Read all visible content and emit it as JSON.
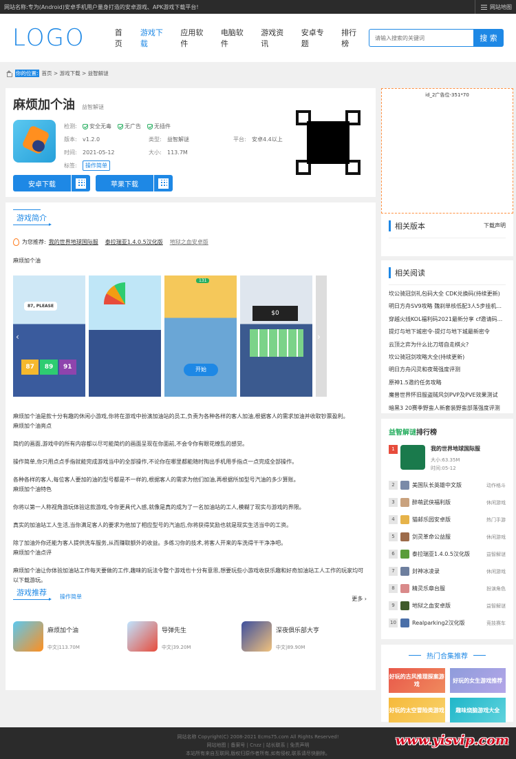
{
  "topbar": {
    "text": "网站名称:专为(Android)安卓手机用户量身打造的安卓游戏、APK游戏下载平台!",
    "sitemap": "网站地图"
  },
  "header": {
    "logo": "LOGO",
    "nav": [
      "首页",
      "游戏下载",
      "应用软件",
      "电脑软件",
      "游戏资讯",
      "安卓专题",
      "排行榜"
    ],
    "active_nav": "游戏下载",
    "search_placeholder": "请输入搜索的关键词",
    "search_button": "搜 索"
  },
  "breadcrumb": {
    "here": "你的位置:",
    "path": "首页 > 游戏下载 > 益智解谜"
  },
  "game": {
    "title": "麻烦加个油",
    "category": "益智解谜",
    "check_label": "检测:",
    "checks": [
      "安全无毒",
      "无广告",
      "无插件"
    ],
    "version_label": "版本:",
    "version": "v1.2.0",
    "type_label": "类型:",
    "type": "益智解谜",
    "platform_label": "平台:",
    "platform": "安卓4.4以上",
    "time_label": "时间:",
    "time": "2021-05-12",
    "size_label": "大小:",
    "size": "113.7M",
    "tag_label": "标签:",
    "tag": "操作简单",
    "android_btn": "安卓下载",
    "ios_btn": "苹果下载"
  },
  "ad": {
    "text": "id_2广告位-351*70"
  },
  "intro": {
    "section_title": "游戏简介",
    "rec_label": "为您推荐:",
    "rec_links": [
      "我的世界地球国际服",
      "泰拉瑞亚1.4.0.5汉化版",
      "地狱之血安卓版"
    ],
    "name_line": "麻烦加个油",
    "shots": {
      "bubble": "87, PLEASE",
      "blocks": [
        "87",
        "89",
        "91"
      ],
      "badge": "131",
      "start": "开始",
      "money": "$0"
    },
    "paragraphs": [
      {
        "text": "麻烦加个油是款十分有趣的休闲小游戏,你将在游戏中扮演加油站的员工,负责为各种各样的客人加油,根据客人的需求加油并收取钞票盈利。",
        "sub": "麻烦加个油亮点"
      },
      {
        "text": "简约的画面,游戏中的所有内容都以尽可能简约的画面呈现在你面前,不会令你有眼花缭乱的感觉。",
        "sub": ""
      },
      {
        "text": "操作简单,你只用点点手指就能完成游戏当中的全部操作,不论你在哪里都能随时掏出手机用手指点一点完成全部操作。",
        "sub": ""
      },
      {
        "text": "各种各样的客人,每位客人要加的油的型号都是不一样的,根据客人的需求为他们加油,再根据所加型号汽油的多少算账。",
        "sub": "麻烦加个油特色"
      },
      {
        "text": "你将以第一人称视角游玩体验这款游戏,令你更具代入感,就像是真的成为了一名加油站的工人,模糊了现实与游戏的界限。",
        "sub": ""
      },
      {
        "text": "真实的加油站工人生活,当你满足客人的要求为他加了相应型号的汽油后,你将获得奖励也就是现实生活当中的工资。",
        "sub": ""
      },
      {
        "text": "除了加油外你还能为客人提供洗车服务,从而赚取额外的收益。多练习你的技术,将客人开来的车洗得干干净净吧。",
        "sub": "麻烦加个油点评"
      },
      {
        "text": "麻烦加个油让你体验加油站工作每天要做的工作,趣味的玩法令整个游戏也十分有意思,想要玩些小游戏收获乐趣和好奇加油站工人工作的玩家均可以下载游玩。",
        "sub": ""
      }
    ]
  },
  "recommend": {
    "title": "游戏推荐",
    "tag": "操作简单",
    "more": "更多",
    "games": [
      {
        "name": "麻烦加个油",
        "sub": "中文|113.70M"
      },
      {
        "name": "导弹先生",
        "sub": "中文|39.20M"
      },
      {
        "name": "深夜俱乐部大亨",
        "sub": "中文|89.90M"
      }
    ]
  },
  "side": {
    "versions_title": "相关版本",
    "versions_link": "下载声明",
    "reads_title": "相关阅读",
    "reads": [
      "坎公骑冠剑礼包码大全 CDK兑换码(持续更新)",
      "明日方舟SV9攻略 魏刹单核低配3人5步挂机...",
      "穿越火线KOL福利码2021最新分享 cf邀请码...",
      "提灯与地下城密令-提灯与地下城最新密令",
      "云顶之弈为什么比刀塔自走棋火?",
      "坎公骑冠剑攻略大全(持续更新)",
      "明日方舟闪灵和夜莺强度评测",
      "原神1.5邀约任务攻略",
      "魔兽世界怀旧服盗贼风剑PVP及PVE效果测试",
      "暗黑3 20赛季野蛮人新套装野蛮部落强度评测"
    ],
    "rank_green": "益智解谜",
    "rank_title": "排行榜",
    "rank_top": {
      "num": "1",
      "name": "我的世界地球国际服",
      "size_label": "大小:",
      "size": "63.35M",
      "time_label": "时间:",
      "time": "05-12"
    },
    "ranks": [
      {
        "num": "2",
        "name": "美国队长英雄中文版",
        "cat": "动作格斗"
      },
      {
        "num": "3",
        "name": "醉萌武侠福利版",
        "cat": "休闲游戏"
      },
      {
        "num": "4",
        "name": "猫邮乐园安卓版",
        "cat": "热门手游"
      },
      {
        "num": "5",
        "name": "剑灵革命公益服",
        "cat": "休闲游戏"
      },
      {
        "num": "6",
        "name": "泰拉瑞亚1.4.0.5汉化版",
        "cat": "益智解谜"
      },
      {
        "num": "7",
        "name": "封神冰凌录",
        "cat": "休闲游戏"
      },
      {
        "num": "8",
        "name": "精灵乐章台服",
        "cat": "扮演角色"
      },
      {
        "num": "9",
        "name": "地狱之血安卓版",
        "cat": "益智解谜"
      },
      {
        "num": "10",
        "name": "Realparking2汉化版",
        "cat": "竞技赛车"
      }
    ],
    "hot_title": "热门合集推荐",
    "hot": [
      "好玩的古风推理探案游戏",
      "好玩的女生游戏推荐",
      "好玩的太空冒险类游戏",
      "趣味烧脑游戏大全"
    ]
  },
  "footer": {
    "line1": "网站名称 Copyright(C) 2008-2021 Ecms75.com All Rights Reserved!",
    "line2": "网站地图 | 备案号 | Cnzz | 站长联系 | 免责声明",
    "line3": "本站所有来自互联网,版权归原作者所有,如有侵权,联系请尽快删除。"
  },
  "watermark": "www.yisvip.com",
  "colors": {
    "accent": "#1e88e5",
    "green": "#27ae60",
    "hot_rank": "#e74c3c",
    "footer_bg": "#2b2b2b"
  }
}
